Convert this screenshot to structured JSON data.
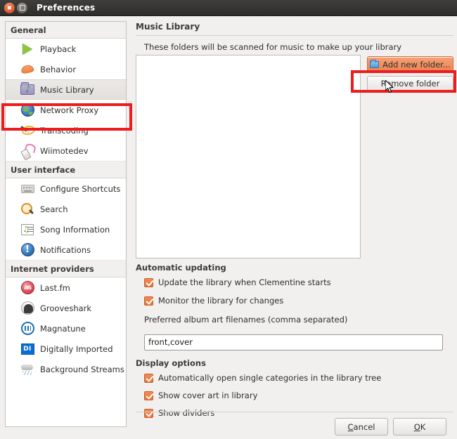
{
  "window": {
    "title": "Preferences",
    "close_icon": "close-icon",
    "maximize_icon": "maximize-icon"
  },
  "sidebar": {
    "groups": [
      {
        "label": "General",
        "items": [
          {
            "label": "Playback",
            "icon": "play-icon",
            "selected": false
          },
          {
            "label": "Behavior",
            "icon": "behavior-icon",
            "selected": false
          },
          {
            "label": "Music Library",
            "icon": "music-folder-icon",
            "selected": true
          },
          {
            "label": "Network Proxy",
            "icon": "globe-icon",
            "selected": false
          },
          {
            "label": "Transcoding",
            "icon": "magic-wand-icon",
            "selected": false
          },
          {
            "label": "Wiimotedev",
            "icon": "wiimote-icon",
            "selected": false
          }
        ]
      },
      {
        "label": "User interface",
        "items": [
          {
            "label": "Configure Shortcuts",
            "icon": "keyboard-icon",
            "selected": false
          },
          {
            "label": "Search",
            "icon": "search-icon",
            "selected": false
          },
          {
            "label": "Song Information",
            "icon": "song-info-icon",
            "selected": false
          },
          {
            "label": "Notifications",
            "icon": "notification-icon",
            "selected": false
          }
        ]
      },
      {
        "label": "Internet providers",
        "items": [
          {
            "label": "Last.fm",
            "icon": "lastfm-icon",
            "selected": false
          },
          {
            "label": "Grooveshark",
            "icon": "grooveshark-icon",
            "selected": false
          },
          {
            "label": "Magnatune",
            "icon": "magnatune-icon",
            "selected": false
          },
          {
            "label": "Digitally Imported",
            "icon": "digitally-imported-icon",
            "selected": false
          },
          {
            "label": "Background Streams",
            "icon": "clouds-icon",
            "selected": false
          }
        ]
      }
    ]
  },
  "main": {
    "title": "Music Library",
    "folders_description": "These folders will be scanned for music to make up your library",
    "folder_list_items": [],
    "add_folder_button": "Add new folder...",
    "add_folder_icon": "folder-icon",
    "remove_folder_button": "Remove folder",
    "automatic_updating": {
      "heading": "Automatic updating",
      "checkboxes": [
        {
          "label": "Update the library when Clementine starts",
          "checked": true
        },
        {
          "label": "Monitor the library for changes",
          "checked": true
        }
      ],
      "album_art_label": "Preferred album art filenames (comma separated)",
      "album_art_value": "front,cover"
    },
    "display_options": {
      "heading": "Display options",
      "checkboxes": [
        {
          "label": "Automatically open single categories in the library tree",
          "checked": true
        },
        {
          "label": "Show cover art in library",
          "checked": true
        },
        {
          "label": "Show dividers",
          "checked": true
        }
      ]
    }
  },
  "footer": {
    "cancel_label": "Cancel",
    "cancel_mnemonic": "C",
    "ok_label": "OK",
    "ok_mnemonic": "O"
  },
  "colors": {
    "accent_orange": "#ed8352",
    "checkbox_orange": "#e8763b",
    "annotation_red": "#ee1c1c",
    "titlebar_dark": "#2f2d2b"
  }
}
